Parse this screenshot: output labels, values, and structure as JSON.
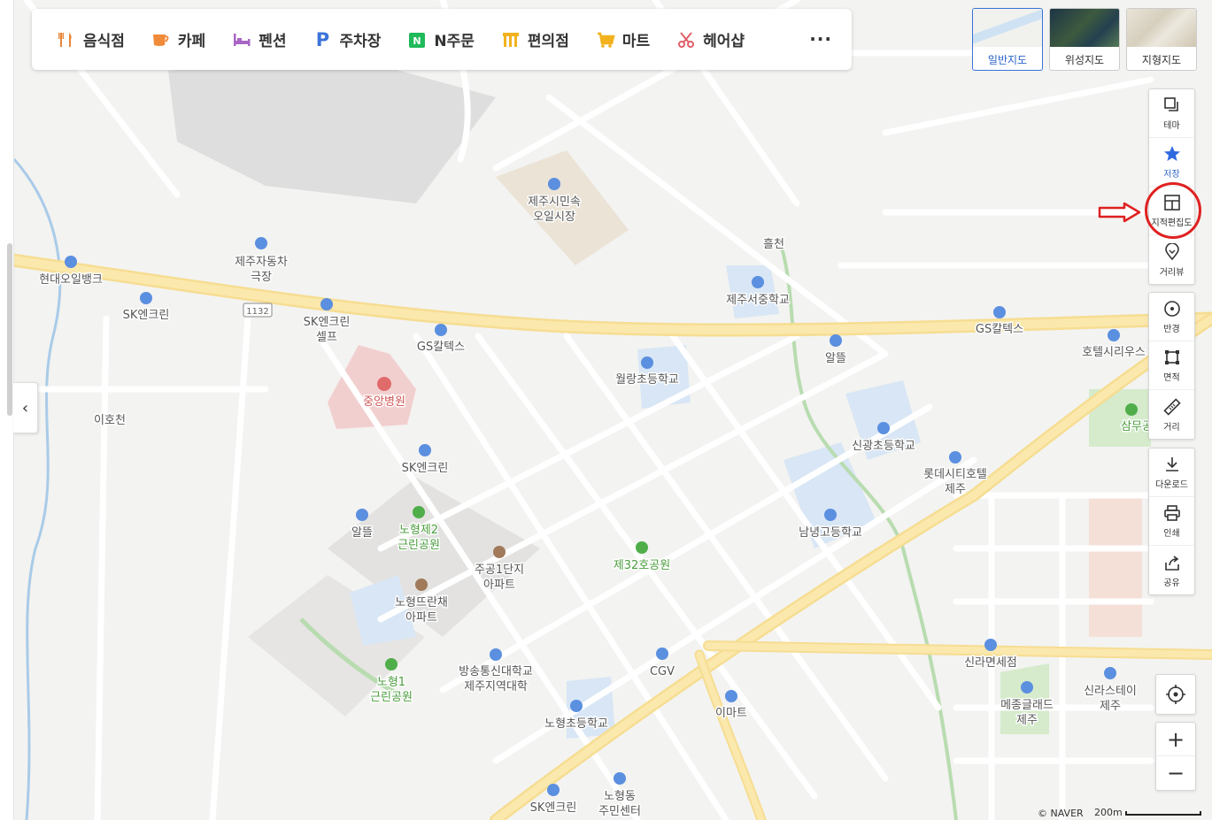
{
  "categories": [
    {
      "label": "음식점",
      "icon": "fork-knife-icon",
      "color": "#e8863a"
    },
    {
      "label": "카페",
      "icon": "cup-icon",
      "color": "#f08b3a"
    },
    {
      "label": "펜션",
      "icon": "bed-icon",
      "color": "#a866c4"
    },
    {
      "label": "주차장",
      "icon": "parking-icon",
      "color": "#3b73d9"
    },
    {
      "label": "N주문",
      "icon": "n-order-icon",
      "color": "#1fba5a"
    },
    {
      "label": "편의점",
      "icon": "store-icon",
      "color": "#f2b21f"
    },
    {
      "label": "마트",
      "icon": "cart-icon",
      "color": "#f2b21f"
    },
    {
      "label": "헤어샵",
      "icon": "scissors-icon",
      "color": "#e0606a"
    }
  ],
  "more_label": "···",
  "map_types": [
    {
      "label": "일반지도",
      "active": true
    },
    {
      "label": "위성지도",
      "active": false
    },
    {
      "label": "지형지도",
      "active": false
    }
  ],
  "tools": {
    "theme": "테마",
    "save": "저장",
    "cadastral": "지적편집도",
    "street_view": "거리뷰",
    "radius": "반경",
    "area": "면적",
    "distance": "거리",
    "download": "다운로드",
    "print": "인쇄",
    "share": "공유"
  },
  "zoom": {
    "in": "+",
    "out": "−"
  },
  "footer": {
    "copyright": "© NAVER",
    "scale": "200m"
  },
  "collapse_label": "‹",
  "map_labels": [
    {
      "id": "hyundai-oilbank",
      "text": "현대오일뱅크"
    },
    {
      "id": "sk-enclean-1",
      "text": "SK엔크린"
    },
    {
      "id": "route-1132",
      "text": "1132"
    },
    {
      "id": "jeju-car-theater-1",
      "text": "제주자동차"
    },
    {
      "id": "jeju-car-theater-2",
      "text": "극장"
    },
    {
      "id": "sk-enclean-self-1",
      "text": "SK엔크린"
    },
    {
      "id": "sk-enclean-self-2",
      "text": "셀프"
    },
    {
      "id": "gs-caltex-1",
      "text": "GS칼텍스"
    },
    {
      "id": "market-1",
      "text": "제주시민속"
    },
    {
      "id": "market-2",
      "text": "오일시장"
    },
    {
      "id": "heulcheon",
      "text": "흘천"
    },
    {
      "id": "seojung-school",
      "text": "제주서중학교"
    },
    {
      "id": "gs-caltex-2",
      "text": "GS칼텍스"
    },
    {
      "id": "altteul-1",
      "text": "알뜰"
    },
    {
      "id": "hotel-sirius",
      "text": "호텔시리우스"
    },
    {
      "id": "wollang-school",
      "text": "월랑초등학교"
    },
    {
      "id": "jungang-hospital",
      "text": "중앙병원"
    },
    {
      "id": "ihocheon",
      "text": "이호천"
    },
    {
      "id": "sinkwang-school",
      "text": "신광초등학교"
    },
    {
      "id": "samu-park",
      "text": "삼무공원"
    },
    {
      "id": "lotte-city-1",
      "text": "롯데시티호텔"
    },
    {
      "id": "lotte-city-2",
      "text": "제주"
    },
    {
      "id": "sk-enclean-2",
      "text": "SK엔크린"
    },
    {
      "id": "altteul-2",
      "text": "알뜰"
    },
    {
      "id": "nohyeong2-park-1",
      "text": "노형제2"
    },
    {
      "id": "nohyeong2-park-2",
      "text": "근린공원"
    },
    {
      "id": "jugong-apt-1",
      "text": "주공1단지"
    },
    {
      "id": "jugong-apt-2",
      "text": "아파트"
    },
    {
      "id": "park-32",
      "text": "제32호공원"
    },
    {
      "id": "namnyeong-school",
      "text": "남녕고등학교"
    },
    {
      "id": "ttranchae-1",
      "text": "노형뜨란채"
    },
    {
      "id": "ttranchae-2",
      "text": "아파트"
    },
    {
      "id": "nohyeong1-park-1",
      "text": "노형1"
    },
    {
      "id": "nohyeong1-park-2",
      "text": "근린공원"
    },
    {
      "id": "knou-1",
      "text": "방송통신대학교"
    },
    {
      "id": "knou-2",
      "text": "제주지역대학"
    },
    {
      "id": "cgv",
      "text": "CGV"
    },
    {
      "id": "silla-dutyfree",
      "text": "신라면세점"
    },
    {
      "id": "shilla-stay-1",
      "text": "신라스테이"
    },
    {
      "id": "shilla-stay-2",
      "text": "제주"
    },
    {
      "id": "maison-glad-1",
      "text": "메종글래드"
    },
    {
      "id": "maison-glad-2",
      "text": "제주"
    },
    {
      "id": "emart",
      "text": "이마트"
    },
    {
      "id": "nohyeong-school",
      "text": "노형초등학교"
    },
    {
      "id": "nohyeong-center-1",
      "text": "노형동"
    },
    {
      "id": "nohyeong-center-2",
      "text": "주민센터"
    },
    {
      "id": "sk-enclean-3",
      "text": "SK엔크린"
    }
  ]
}
